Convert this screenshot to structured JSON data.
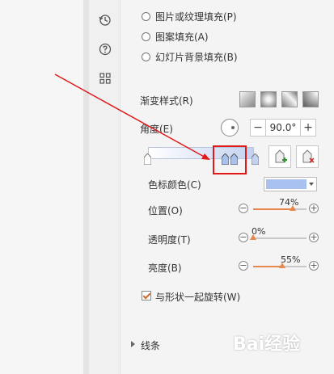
{
  "fill_options": [
    {
      "label": "图片或纹理填充(P)"
    },
    {
      "label": "图案填充(A)"
    },
    {
      "label": "幻灯片背景填充(B)"
    }
  ],
  "gradient_style": {
    "label": "渐变样式(R)"
  },
  "angle": {
    "label": "角度(E)",
    "value": "90.0°",
    "minus": "−",
    "plus": "+"
  },
  "stop_color": {
    "label": "色标颜色(C)",
    "color": "#a9c1ee"
  },
  "position": {
    "label": "位置(O)",
    "value": "74%",
    "level": 74
  },
  "transparency": {
    "label": "透明度(T)",
    "value": "0%",
    "level": 0
  },
  "brightness": {
    "label": "亮度(B)",
    "value": "55%",
    "level": 55
  },
  "rotate_with_shape": {
    "label": "与形状一起旋转(W)",
    "checked": true
  },
  "line_section": {
    "label": "线条"
  },
  "watermark": "Bai经验",
  "colors": {
    "accent": "#e8874c",
    "highlight": "#e01818",
    "arrow": "#e01818",
    "gradient_end": "#c3d2f0"
  },
  "side_icons": [
    "history-icon",
    "help-icon",
    "grid-icon"
  ]
}
